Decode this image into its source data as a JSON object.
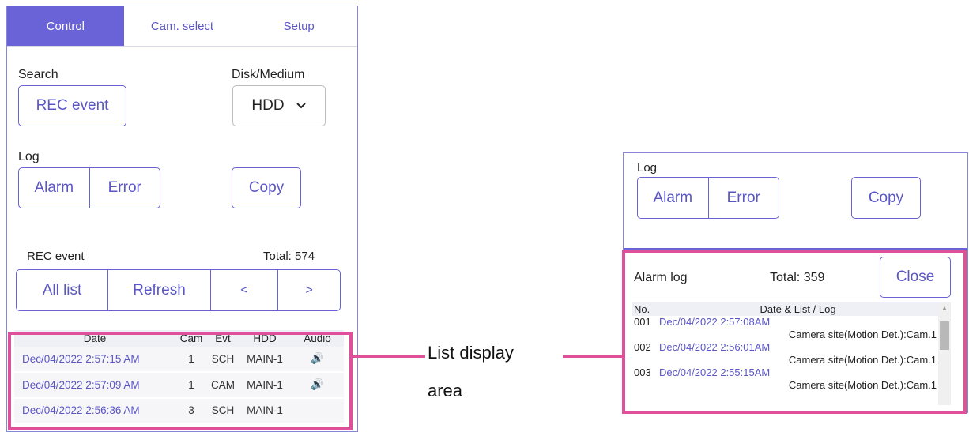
{
  "left_panel": {
    "tabs": [
      "Control",
      "Cam. select",
      "Setup"
    ],
    "search_label": "Search",
    "rec_event_button": "REC event",
    "disk_label": "Disk/Medium",
    "disk_value": "HDD",
    "log_label": "Log",
    "alarm_button": "Alarm",
    "error_button": "Error",
    "copy_button": "Copy",
    "rec_event_label": "REC event",
    "total_text": "Total:  574",
    "nav_buttons": [
      "All list",
      "Refresh",
      "<",
      ">"
    ],
    "table": {
      "headers": [
        "Date",
        "Cam",
        "Evt",
        "HDD",
        "Audio"
      ],
      "rows": [
        {
          "date": "Dec/04/2022 2:57:15 AM",
          "cam": "1",
          "evt": "SCH",
          "hdd": "MAIN-1",
          "audio": "🔊"
        },
        {
          "date": "Dec/04/2022 2:57:09 AM",
          "cam": "1",
          "evt": "CAM",
          "hdd": "MAIN-1",
          "audio": "🔊"
        },
        {
          "date": "Dec/04/2022 2:56:36 AM",
          "cam": "3",
          "evt": "SCH",
          "hdd": "MAIN-1",
          "audio": ""
        }
      ]
    }
  },
  "callout": {
    "line1": "List display",
    "line2": "area"
  },
  "right_panel": {
    "log_label": "Log",
    "alarm_button": "Alarm",
    "error_button": "Error",
    "copy_button": "Copy",
    "alarm_log_label": "Alarm log",
    "total_text": "Total:  359",
    "close_button": "Close",
    "table": {
      "headers": [
        "No.",
        "Date & List / Log"
      ],
      "rows": [
        {
          "no": "001",
          "date": "Dec/04/2022 2:57:08AM",
          "msg": "Camera site(Motion Det.):Cam.1"
        },
        {
          "no": "002",
          "date": "Dec/04/2022 2:56:01AM",
          "msg": "Camera site(Motion Det.):Cam.1"
        },
        {
          "no": "003",
          "date": "Dec/04/2022 2:55:15AM",
          "msg": "Camera site(Motion Det.):Cam.1"
        }
      ]
    }
  },
  "colors": {
    "accent": "#6a63d8",
    "highlight": "#e0509a"
  },
  "icons": [
    "chevron-down-icon",
    "speaker-icon",
    "scroll-up-icon"
  ]
}
